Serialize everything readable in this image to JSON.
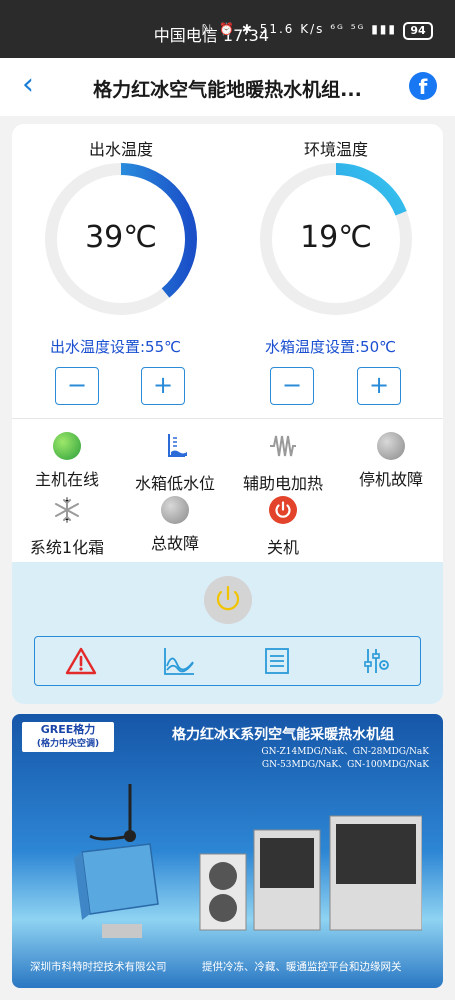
{
  "statusbar": {
    "carrier_time": "中国电信 17:34",
    "icons": "ℕ ⏰ ✱ 51.6 K/s ⁶ᴳ ⁵ᴳ ▮▮▮",
    "battery": "94"
  },
  "appbar": {
    "back": "‹",
    "title": "格力红冰空气能地暖热水机组...",
    "fb": "f"
  },
  "gauges": {
    "outlet": {
      "title": "出水温度",
      "value": "39℃",
      "level": 0.39,
      "setting": "出水温度设置:55℃"
    },
    "ambient": {
      "title": "环境温度",
      "value": "19℃",
      "level": 0.19,
      "setting": "水箱温度设置:50℃"
    }
  },
  "buttons": {
    "minus": "−",
    "plus": "+"
  },
  "indicators": [
    {
      "label": "主机在线",
      "icon": "online-dot-icon",
      "color": "#39b54a"
    },
    {
      "label": "水箱低水位",
      "icon": "water-level-icon",
      "color": "#2a6bd8"
    },
    {
      "label": "辅助电加热",
      "icon": "heater-icon",
      "color": "#9a9a9a"
    },
    {
      "label": "停机故障",
      "icon": "fault-dot-icon",
      "color": "#9a9a9a"
    },
    {
      "label": "系统1化霜",
      "icon": "snowflake-icon",
      "color": "#9a9a9a"
    },
    {
      "label": "总故障",
      "icon": "fault-dot-icon",
      "color": "#9a9a9a"
    },
    {
      "label": "关机",
      "icon": "power-icon",
      "color": "#e84a2a"
    }
  ],
  "toolbar": [
    "alarm-icon",
    "chart-icon",
    "list-icon",
    "settings-icon"
  ],
  "banner": {
    "brand": "GREE格力",
    "brand_sub": "(格力中央空调)",
    "headline": "格力红冰K系列空气能采暖热水机组",
    "models_1": "GN-Z14MDG/NaK、GN-28MDG/NaK",
    "models_2": "GN-53MDG/NaK、GN-100MDG/NaK",
    "footer_left": "深圳市科特时控技术有限公司",
    "footer_right": "提供冷冻、冷藏、暖通监控平台和边缘网关"
  }
}
